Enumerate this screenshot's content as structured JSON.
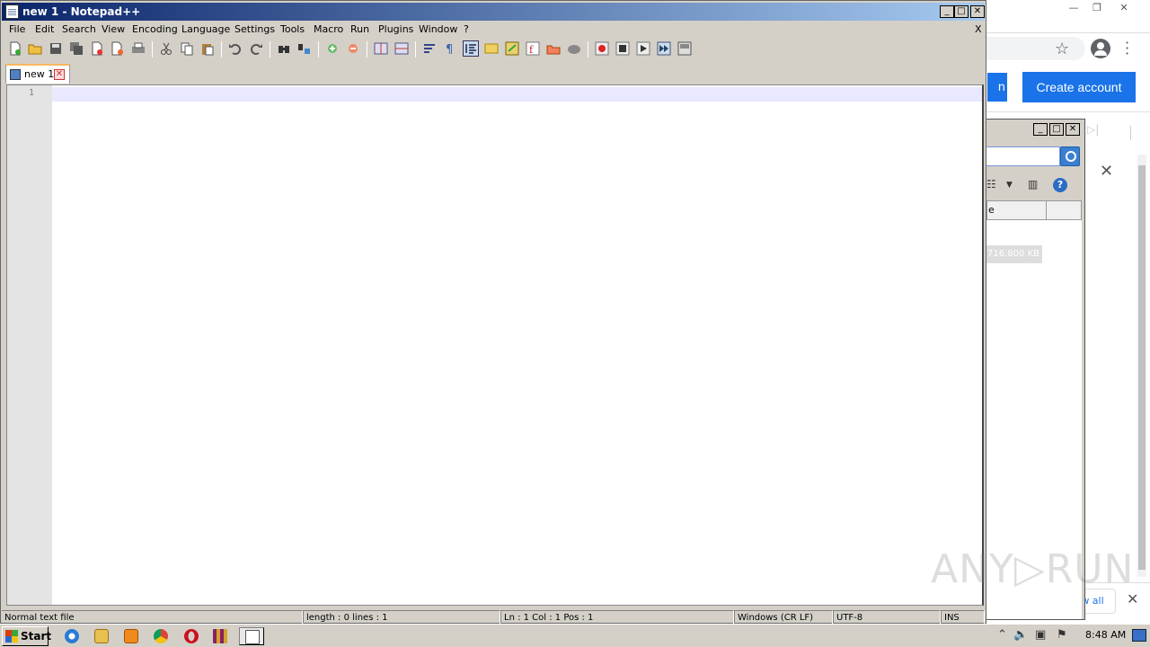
{
  "chrome": {
    "signin_label": "n",
    "create_account_label": "Create account",
    "show_all_label": "w all",
    "minimize_glyph": "—",
    "restore_glyph": "❐",
    "close_glyph": "✕",
    "star_glyph": "☆",
    "panel_close_glyph": "✕",
    "media_end_glyph": "▷|",
    "downloads_close_glyph": "✕"
  },
  "explorer": {
    "minimize_glyph": "_",
    "maximize_glyph": "□",
    "close_glyph": "✕",
    "column_size_label": "e",
    "file_size": "716,800 KB",
    "view_glyph": "☷",
    "dropdown_glyph": "▼",
    "pane_glyph": "▥",
    "help_glyph": "?"
  },
  "notepad": {
    "title": "new 1 - Notepad++",
    "minimize_glyph": "_",
    "maximize_glyph": "□",
    "close_glyph": "✕",
    "menu": [
      "File",
      "Edit",
      "Search",
      "View",
      "Encoding",
      "Language",
      "Settings",
      "Tools",
      "Macro",
      "Run",
      "Plugins",
      "Window",
      "?"
    ],
    "menu_close_doc": "X",
    "tab": {
      "label": "new 1",
      "close_glyph": "✕"
    },
    "line_number": "1",
    "status": {
      "type": "Normal text file",
      "length": "length : 0    lines : 1",
      "position": "Ln : 1    Col : 1    Pos : 1",
      "eol": "Windows (CR LF)",
      "encoding": "UTF-8",
      "mode": "INS"
    }
  },
  "taskbar": {
    "start_label": "Start",
    "clock": "8:48 AM",
    "tray_up_glyph": "⌃",
    "tray_volume_glyph": "🔈",
    "tray_network_glyph": "▣",
    "tray_flag_glyph": "⚑"
  },
  "watermark": "ANY▷RUN"
}
